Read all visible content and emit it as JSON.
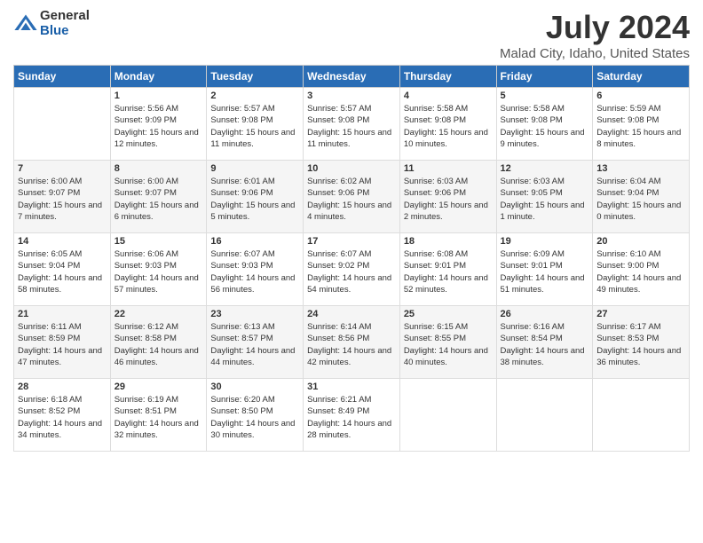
{
  "logo": {
    "general": "General",
    "blue": "Blue"
  },
  "title": "July 2024",
  "subtitle": "Malad City, Idaho, United States",
  "headers": [
    "Sunday",
    "Monday",
    "Tuesday",
    "Wednesday",
    "Thursday",
    "Friday",
    "Saturday"
  ],
  "weeks": [
    [
      {
        "day": "",
        "sunrise": "",
        "sunset": "",
        "daylight": ""
      },
      {
        "day": "1",
        "sunrise": "Sunrise: 5:56 AM",
        "sunset": "Sunset: 9:09 PM",
        "daylight": "Daylight: 15 hours and 12 minutes."
      },
      {
        "day": "2",
        "sunrise": "Sunrise: 5:57 AM",
        "sunset": "Sunset: 9:08 PM",
        "daylight": "Daylight: 15 hours and 11 minutes."
      },
      {
        "day": "3",
        "sunrise": "Sunrise: 5:57 AM",
        "sunset": "Sunset: 9:08 PM",
        "daylight": "Daylight: 15 hours and 11 minutes."
      },
      {
        "day": "4",
        "sunrise": "Sunrise: 5:58 AM",
        "sunset": "Sunset: 9:08 PM",
        "daylight": "Daylight: 15 hours and 10 minutes."
      },
      {
        "day": "5",
        "sunrise": "Sunrise: 5:58 AM",
        "sunset": "Sunset: 9:08 PM",
        "daylight": "Daylight: 15 hours and 9 minutes."
      },
      {
        "day": "6",
        "sunrise": "Sunrise: 5:59 AM",
        "sunset": "Sunset: 9:08 PM",
        "daylight": "Daylight: 15 hours and 8 minutes."
      }
    ],
    [
      {
        "day": "7",
        "sunrise": "Sunrise: 6:00 AM",
        "sunset": "Sunset: 9:07 PM",
        "daylight": "Daylight: 15 hours and 7 minutes."
      },
      {
        "day": "8",
        "sunrise": "Sunrise: 6:00 AM",
        "sunset": "Sunset: 9:07 PM",
        "daylight": "Daylight: 15 hours and 6 minutes."
      },
      {
        "day": "9",
        "sunrise": "Sunrise: 6:01 AM",
        "sunset": "Sunset: 9:06 PM",
        "daylight": "Daylight: 15 hours and 5 minutes."
      },
      {
        "day": "10",
        "sunrise": "Sunrise: 6:02 AM",
        "sunset": "Sunset: 9:06 PM",
        "daylight": "Daylight: 15 hours and 4 minutes."
      },
      {
        "day": "11",
        "sunrise": "Sunrise: 6:03 AM",
        "sunset": "Sunset: 9:06 PM",
        "daylight": "Daylight: 15 hours and 2 minutes."
      },
      {
        "day": "12",
        "sunrise": "Sunrise: 6:03 AM",
        "sunset": "Sunset: 9:05 PM",
        "daylight": "Daylight: 15 hours and 1 minute."
      },
      {
        "day": "13",
        "sunrise": "Sunrise: 6:04 AM",
        "sunset": "Sunset: 9:04 PM",
        "daylight": "Daylight: 15 hours and 0 minutes."
      }
    ],
    [
      {
        "day": "14",
        "sunrise": "Sunrise: 6:05 AM",
        "sunset": "Sunset: 9:04 PM",
        "daylight": "Daylight: 14 hours and 58 minutes."
      },
      {
        "day": "15",
        "sunrise": "Sunrise: 6:06 AM",
        "sunset": "Sunset: 9:03 PM",
        "daylight": "Daylight: 14 hours and 57 minutes."
      },
      {
        "day": "16",
        "sunrise": "Sunrise: 6:07 AM",
        "sunset": "Sunset: 9:03 PM",
        "daylight": "Daylight: 14 hours and 56 minutes."
      },
      {
        "day": "17",
        "sunrise": "Sunrise: 6:07 AM",
        "sunset": "Sunset: 9:02 PM",
        "daylight": "Daylight: 14 hours and 54 minutes."
      },
      {
        "day": "18",
        "sunrise": "Sunrise: 6:08 AM",
        "sunset": "Sunset: 9:01 PM",
        "daylight": "Daylight: 14 hours and 52 minutes."
      },
      {
        "day": "19",
        "sunrise": "Sunrise: 6:09 AM",
        "sunset": "Sunset: 9:01 PM",
        "daylight": "Daylight: 14 hours and 51 minutes."
      },
      {
        "day": "20",
        "sunrise": "Sunrise: 6:10 AM",
        "sunset": "Sunset: 9:00 PM",
        "daylight": "Daylight: 14 hours and 49 minutes."
      }
    ],
    [
      {
        "day": "21",
        "sunrise": "Sunrise: 6:11 AM",
        "sunset": "Sunset: 8:59 PM",
        "daylight": "Daylight: 14 hours and 47 minutes."
      },
      {
        "day": "22",
        "sunrise": "Sunrise: 6:12 AM",
        "sunset": "Sunset: 8:58 PM",
        "daylight": "Daylight: 14 hours and 46 minutes."
      },
      {
        "day": "23",
        "sunrise": "Sunrise: 6:13 AM",
        "sunset": "Sunset: 8:57 PM",
        "daylight": "Daylight: 14 hours and 44 minutes."
      },
      {
        "day": "24",
        "sunrise": "Sunrise: 6:14 AM",
        "sunset": "Sunset: 8:56 PM",
        "daylight": "Daylight: 14 hours and 42 minutes."
      },
      {
        "day": "25",
        "sunrise": "Sunrise: 6:15 AM",
        "sunset": "Sunset: 8:55 PM",
        "daylight": "Daylight: 14 hours and 40 minutes."
      },
      {
        "day": "26",
        "sunrise": "Sunrise: 6:16 AM",
        "sunset": "Sunset: 8:54 PM",
        "daylight": "Daylight: 14 hours and 38 minutes."
      },
      {
        "day": "27",
        "sunrise": "Sunrise: 6:17 AM",
        "sunset": "Sunset: 8:53 PM",
        "daylight": "Daylight: 14 hours and 36 minutes."
      }
    ],
    [
      {
        "day": "28",
        "sunrise": "Sunrise: 6:18 AM",
        "sunset": "Sunset: 8:52 PM",
        "daylight": "Daylight: 14 hours and 34 minutes."
      },
      {
        "day": "29",
        "sunrise": "Sunrise: 6:19 AM",
        "sunset": "Sunset: 8:51 PM",
        "daylight": "Daylight: 14 hours and 32 minutes."
      },
      {
        "day": "30",
        "sunrise": "Sunrise: 6:20 AM",
        "sunset": "Sunset: 8:50 PM",
        "daylight": "Daylight: 14 hours and 30 minutes."
      },
      {
        "day": "31",
        "sunrise": "Sunrise: 6:21 AM",
        "sunset": "Sunset: 8:49 PM",
        "daylight": "Daylight: 14 hours and 28 minutes."
      },
      {
        "day": "",
        "sunrise": "",
        "sunset": "",
        "daylight": ""
      },
      {
        "day": "",
        "sunrise": "",
        "sunset": "",
        "daylight": ""
      },
      {
        "day": "",
        "sunrise": "",
        "sunset": "",
        "daylight": ""
      }
    ]
  ]
}
